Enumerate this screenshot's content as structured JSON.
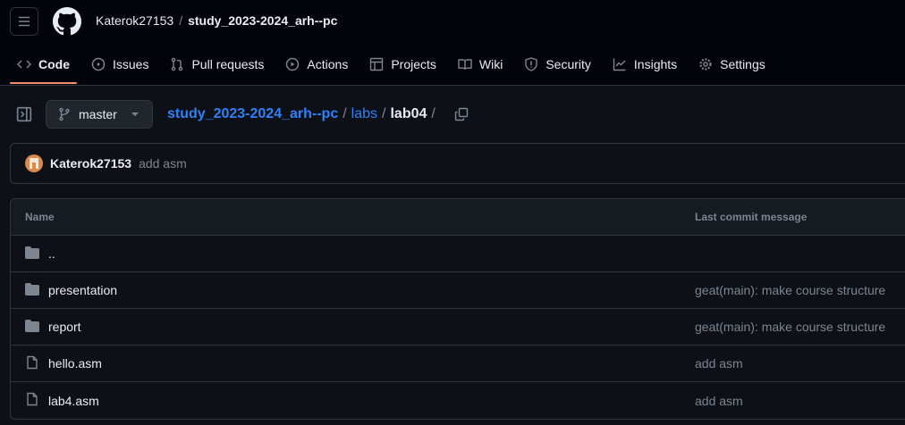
{
  "header": {
    "owner": "Katerok27153",
    "separator": "/",
    "repo": "study_2023-2024_arh--pc"
  },
  "nav": [
    {
      "label": "Code",
      "icon": "code-icon"
    },
    {
      "label": "Issues",
      "icon": "issue-icon"
    },
    {
      "label": "Pull requests",
      "icon": "pull-request-icon"
    },
    {
      "label": "Actions",
      "icon": "play-icon"
    },
    {
      "label": "Projects",
      "icon": "table-icon"
    },
    {
      "label": "Wiki",
      "icon": "book-icon"
    },
    {
      "label": "Security",
      "icon": "shield-icon"
    },
    {
      "label": "Insights",
      "icon": "graph-icon"
    },
    {
      "label": "Settings",
      "icon": "gear-icon"
    }
  ],
  "branch": "master",
  "breadcrumb": {
    "repo": "study_2023-2024_arh--pc",
    "sep": "/",
    "dir": "labs",
    "current": "lab04"
  },
  "commit": {
    "author": "Katerok27153",
    "message": "add asm"
  },
  "table": {
    "headers": {
      "name": "Name",
      "message": "Last commit message"
    },
    "rows": [
      {
        "name": "..",
        "type": "folder",
        "message": ""
      },
      {
        "name": "presentation",
        "type": "folder",
        "message": "geat(main): make course structure"
      },
      {
        "name": "report",
        "type": "folder",
        "message": "geat(main): make course structure"
      },
      {
        "name": "hello.asm",
        "type": "file",
        "message": "add asm"
      },
      {
        "name": "lab4.asm",
        "type": "file",
        "message": "add asm"
      }
    ]
  }
}
